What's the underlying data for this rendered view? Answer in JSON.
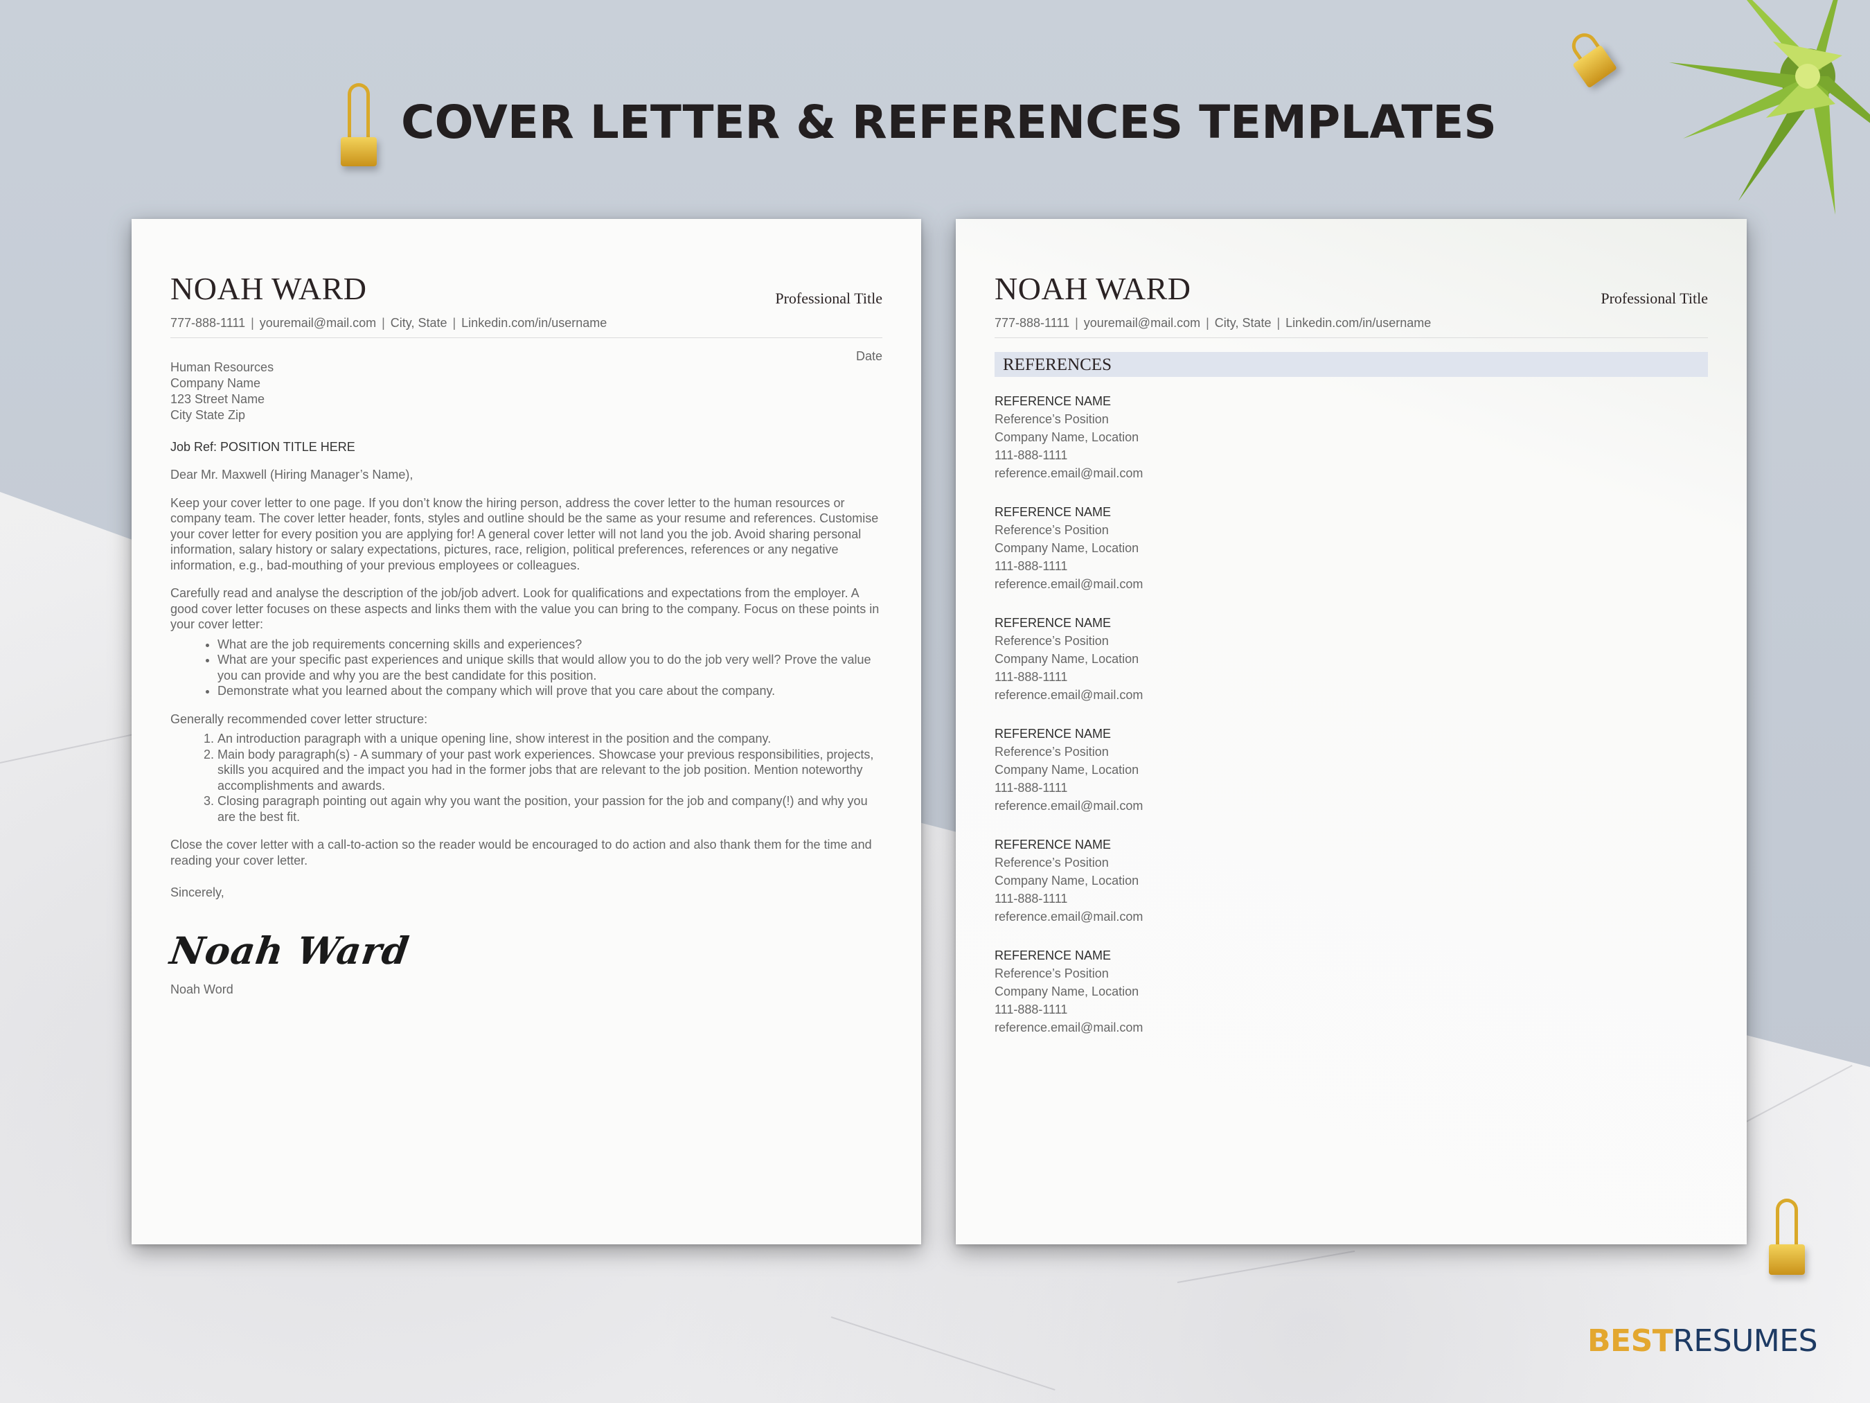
{
  "banner": {
    "title": "COVER LETTER  & REFERENCES TEMPLATES"
  },
  "brand": {
    "best": "BEST",
    "resumes": "RESUMES",
    "colors": {
      "best": "#e3a72f",
      "resumes": "#1d3a63"
    }
  },
  "header": {
    "name": "NOAH WARD",
    "professional_title": "Professional Title",
    "contact": [
      "777-888-1111",
      "youremail@mail.com",
      "City, State",
      "Linkedin.com/in/username"
    ],
    "separator": "|"
  },
  "cover_letter": {
    "date": "Date",
    "recipient": [
      "Human Resources",
      "Company Name",
      "123 Street Name",
      "City State Zip"
    ],
    "job_ref": "Job Ref: POSITION TITLE HERE",
    "salutation": "Dear Mr. Maxwell (Hiring Manager’s Name),",
    "paragraph_1": "Keep your cover letter to one page. If you don’t know the hiring person, address the cover letter to the human resources or company team. The cover letter header, fonts, styles and outline should be the same as your resume and references. Customise your cover letter for every position you are applying for! A general cover letter will not land you the job. Avoid sharing personal information, salary history or salary expectations, pictures, race, religion, political preferences, references or any negative information, e.g., bad-mouthing of your previous employees or colleagues.",
    "paragraph_2": "Carefully read and analyse the description of the job/job advert. Look for qualifications and expectations from the employer. A good cover letter focuses on these aspects and links them with the value you can bring to the company. Focus on these points in your cover letter:",
    "bullets": [
      "What are the job requirements concerning skills and experiences?",
      "What are your specific past experiences and unique skills that would allow you to do the job very well? Prove the value you can provide and why you are the best candidate for this position.",
      "Demonstrate what you learned about the company which will prove that you care about the company."
    ],
    "structure_intro": "Generally recommended cover letter structure:",
    "structure": [
      "An introduction paragraph with a unique opening line, show interest in the position and the company.",
      "Main body paragraph(s) - A summary of your past work experiences. Showcase your previous responsibilities, projects, skills you acquired and the impact you had in the former jobs that are relevant to the job position. Mention noteworthy accomplishments and awards.",
      "Closing paragraph pointing out again why you want the position, your passion for the job and company(!) and why you are the best fit."
    ],
    "closing": "Close the cover letter with a call-to-action so the reader would be encouraged to do action and also thank them for the time and reading your cover letter.",
    "sign_off": "Sincerely,",
    "signature": "Noah Ward",
    "signed_name": "Noah Word"
  },
  "references": {
    "heading": "REFERENCES",
    "items": [
      {
        "name": "REFERENCE NAME",
        "position": "Reference’s Position",
        "company": "Company Name, Location",
        "phone": "111-888-1111",
        "email": "reference.email@mail.com"
      },
      {
        "name": "REFERENCE NAME",
        "position": "Reference’s Position",
        "company": "Company Name, Location",
        "phone": "111-888-1111",
        "email": "reference.email@mail.com"
      },
      {
        "name": "REFERENCE NAME",
        "position": "Reference’s Position",
        "company": "Company Name, Location",
        "phone": "111-888-1111",
        "email": "reference.email@mail.com"
      },
      {
        "name": "REFERENCE NAME",
        "position": "Reference’s Position",
        "company": "Company Name, Location",
        "phone": "111-888-1111",
        "email": "reference.email@mail.com"
      },
      {
        "name": "REFERENCE NAME",
        "position": "Reference’s Position",
        "company": "Company Name, Location",
        "phone": "111-888-1111",
        "email": "reference.email@mail.com"
      },
      {
        "name": "REFERENCE NAME",
        "position": "Reference’s Position",
        "company": "Company Name, Location",
        "phone": "111-888-1111",
        "email": "reference.email@mail.com"
      }
    ]
  },
  "decor": {
    "icons": [
      "binder-clip-icon",
      "succulent-plant-icon"
    ],
    "accent_colors": {
      "clip_gold": "#d9a92a",
      "heading_band": "#dfe4ee"
    }
  }
}
